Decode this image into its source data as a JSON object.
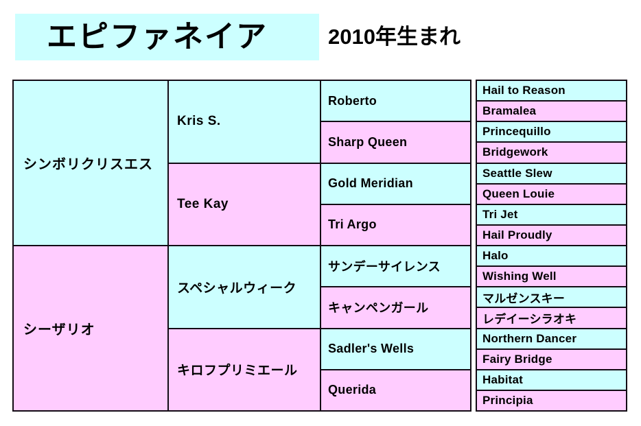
{
  "header": {
    "title": "エピファネイア",
    "subtitle": "2010年生まれ",
    "title_bg_color": "#ccffff"
  },
  "palette": {
    "sire_color": "#ccffff",
    "dam_color": "#ffccff",
    "border_color": "#120a14",
    "page_bg": "#ffffff"
  },
  "pedigree": {
    "generation_1": [
      {
        "name": "シンボリクリスエス",
        "sex": "sire",
        "color": "#ccffff"
      },
      {
        "name": "シーザリオ",
        "sex": "dam",
        "color": "#ffccff"
      }
    ],
    "generation_2": [
      {
        "name": "Kris S.",
        "sex": "sire",
        "color": "#ccffff"
      },
      {
        "name": "Tee Kay",
        "sex": "dam",
        "color": "#ffccff"
      },
      {
        "name": "スペシャルウィーク",
        "sex": "sire",
        "color": "#ccffff"
      },
      {
        "name": "キロフプリミエール",
        "sex": "dam",
        "color": "#ffccff"
      }
    ],
    "generation_3": [
      {
        "name": "Roberto",
        "sex": "sire",
        "color": "#ccffff"
      },
      {
        "name": "Sharp Queen",
        "sex": "dam",
        "color": "#ffccff"
      },
      {
        "name": "Gold Meridian",
        "sex": "sire",
        "color": "#ccffff"
      },
      {
        "name": "Tri Argo",
        "sex": "dam",
        "color": "#ffccff"
      },
      {
        "name": "サンデーサイレンス",
        "sex": "sire",
        "color": "#ccffff"
      },
      {
        "name": "キャンペンガール",
        "sex": "dam",
        "color": "#ffccff"
      },
      {
        "name": "Sadler's Wells",
        "sex": "sire",
        "color": "#ccffff"
      },
      {
        "name": "Querida",
        "sex": "dam",
        "color": "#ffccff"
      }
    ],
    "generation_4": [
      {
        "name": "Hail to Reason",
        "sex": "sire",
        "color": "#ccffff"
      },
      {
        "name": "Bramalea",
        "sex": "dam",
        "color": "#ffccff"
      },
      {
        "name": "Princequillo",
        "sex": "sire",
        "color": "#ccffff"
      },
      {
        "name": "Bridgework",
        "sex": "dam",
        "color": "#ffccff"
      },
      {
        "name": "Seattle Slew",
        "sex": "sire",
        "color": "#ccffff"
      },
      {
        "name": "Queen Louie",
        "sex": "dam",
        "color": "#ffccff"
      },
      {
        "name": "Tri Jet",
        "sex": "sire",
        "color": "#ccffff"
      },
      {
        "name": "Hail Proudly",
        "sex": "dam",
        "color": "#ffccff"
      },
      {
        "name": "Halo",
        "sex": "sire",
        "color": "#ccffff"
      },
      {
        "name": "Wishing Well",
        "sex": "dam",
        "color": "#ffccff"
      },
      {
        "name": "マルゼンスキー",
        "sex": "sire",
        "color": "#ccffff"
      },
      {
        "name": "レデイーシラオキ",
        "sex": "dam",
        "color": "#ffccff"
      },
      {
        "name": "Northern Dancer",
        "sex": "sire",
        "color": "#ccffff"
      },
      {
        "name": "Fairy Bridge",
        "sex": "dam",
        "color": "#ffccff"
      },
      {
        "name": "Habitat",
        "sex": "sire",
        "color": "#ccffff"
      },
      {
        "name": "Principia",
        "sex": "dam",
        "color": "#ffccff"
      }
    ]
  }
}
